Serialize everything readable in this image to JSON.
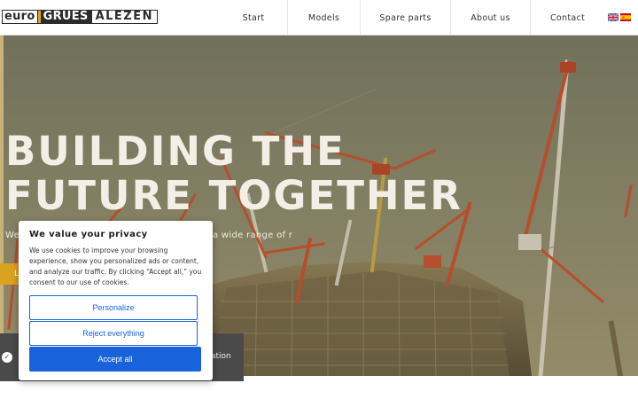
{
  "header": {
    "logo": {
      "part1": "euro",
      "part2": "GRUES",
      "part3": "ALEZEN"
    },
    "nav": [
      {
        "label": "Start"
      },
      {
        "label": "Models"
      },
      {
        "label": "Spare parts"
      },
      {
        "label": "About us"
      },
      {
        "label": "Contact"
      }
    ],
    "languages": [
      "english-flag-icon",
      "spanish-flag-icon"
    ]
  },
  "hero": {
    "headline_line1": "BUILDING THE",
    "headline_line2": "FUTURE TOGETHER",
    "subtitle": "We                                             s and have a wide range of r                                             na factory",
    "cta_label": "L"
  },
  "info_bar": {
    "tail_text": "ation"
  },
  "cookie": {
    "title": "We value your privacy",
    "body": "We use cookies to improve your browsing experience, show you personalized ads or content, and analyze our traffic. By clicking “Accept all,” you consent to our use of cookies.",
    "personalize_label": "Personalize",
    "reject_label": "Reject everything",
    "accept_label": "Accept all"
  },
  "colors": {
    "accent": "#d9a21f",
    "cookie_button": "#1863dc",
    "dark_bar": "#4a4a4a"
  }
}
